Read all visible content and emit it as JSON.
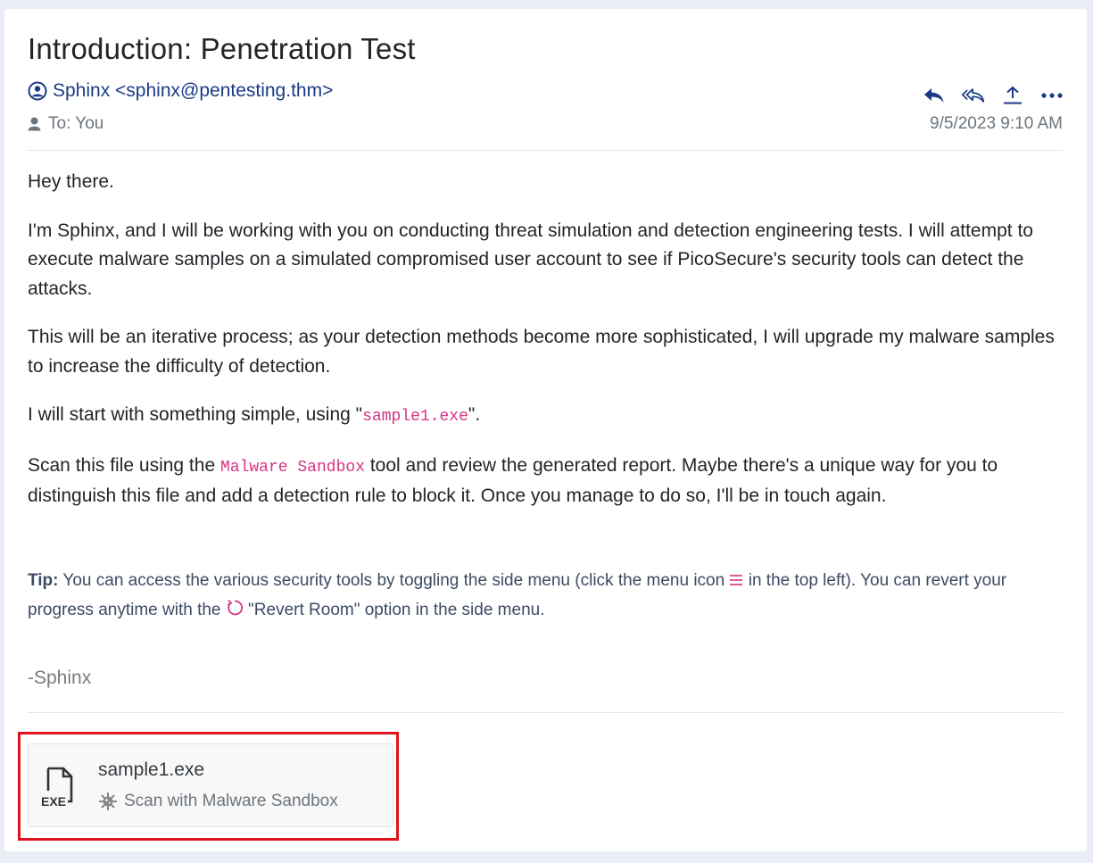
{
  "email": {
    "subject": "Introduction: Penetration Test",
    "from": "Sphinx <sphinx@pentesting.thm>",
    "to": "To: You",
    "date": "9/5/2023 9:10 AM"
  },
  "actions": [
    {
      "name": "reply-icon"
    },
    {
      "name": "reply-all-icon"
    },
    {
      "name": "forward-icon"
    },
    {
      "name": "more-icon"
    }
  ],
  "body": {
    "greeting": "Hey there.",
    "p1": "I'm Sphinx, and I will be working with you on conducting threat simulation and detection engineering tests. I will attempt to execute malware samples on a simulated compromised user account to see if PicoSecure's security tools can detect the attacks.",
    "p2": "This will be an iterative process; as your detection methods become more sophisticated, I will upgrade my malware samples to increase the difficulty of detection.",
    "p3_before": "I will start with something simple, using \"",
    "p3_code": "sample1.exe",
    "p3_after": "\".",
    "p4_before": "Scan this file using the ",
    "p4_code": "Malware Sandbox",
    "p4_after": " tool and review the generated report. Maybe there's a unique way for you to distinguish this file and add a detection rule to block it. Once you manage to do so, I'll be in touch again."
  },
  "tip": {
    "label": "Tip:",
    "text1": " You can access the various security tools by toggling the side menu (click the menu icon ",
    "text2": " in the top left). You can revert your progress anytime with the ",
    "text3": " \"Revert Room\" option in the side menu."
  },
  "signature": "-Sphinx",
  "attachment": {
    "filename": "sample1.exe",
    "icon_label": "EXE",
    "scan_label": "Scan with Malware Sandbox"
  },
  "colors": {
    "link": "#1b3a86",
    "code": "#d63384",
    "highlight": "#e0141a"
  }
}
